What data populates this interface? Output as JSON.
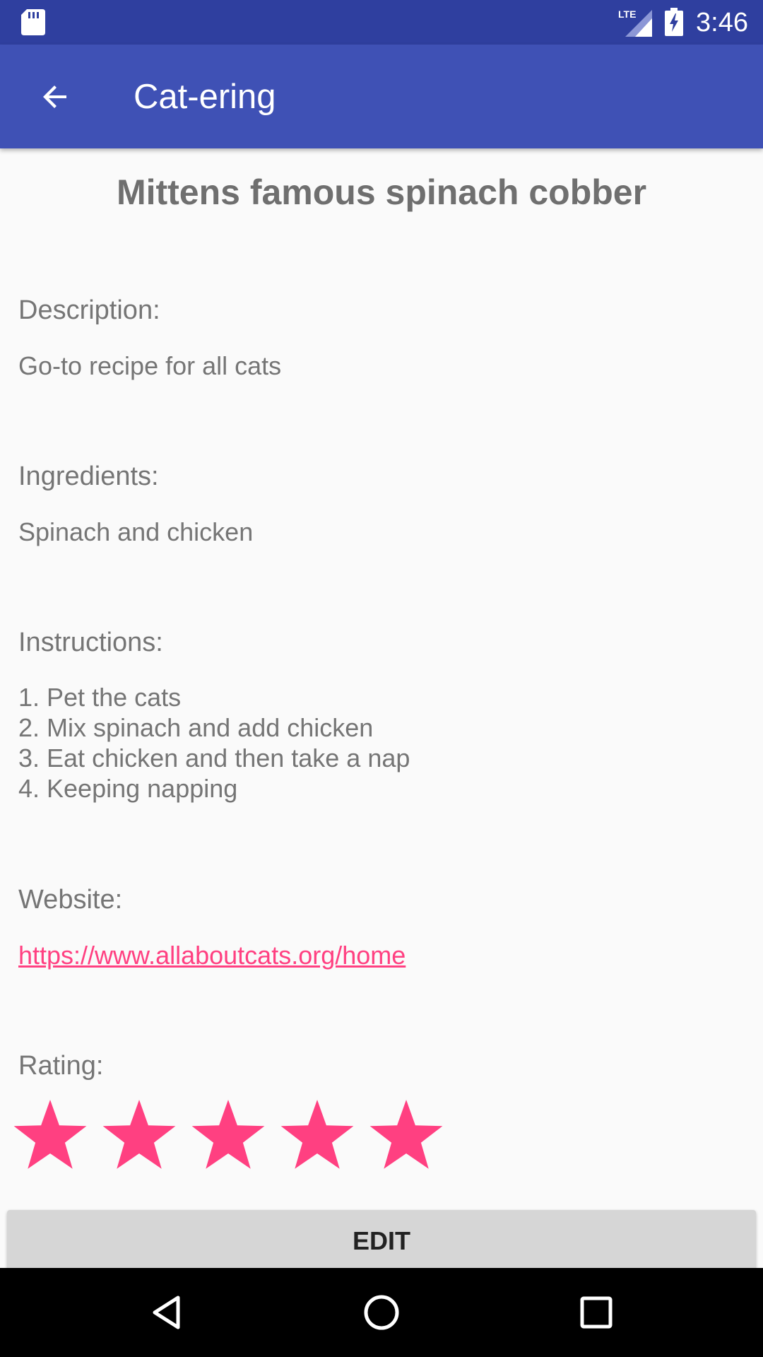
{
  "status_bar": {
    "time": "3:46",
    "network": "LTE",
    "icons": [
      "sd-card-icon",
      "lte-signal-icon",
      "battery-charging-icon"
    ]
  },
  "app_bar": {
    "title": "Cat-ering",
    "back_icon": "arrow-back-icon"
  },
  "recipe": {
    "title": "Mittens famous spinach cobber",
    "description_label": "Description:",
    "description": "Go-to recipe for all cats",
    "ingredients_label": "Ingredients:",
    "ingredients": "Spinach and chicken",
    "instructions_label": "Instructions:",
    "instructions": [
      "1. Pet the cats",
      "2. Mix spinach and add chicken",
      "3. Eat chicken and then take a nap",
      "4. Keeping napping"
    ],
    "website_label": "Website:",
    "website": "https://www.allaboutcats.org/home",
    "rating_label": "Rating:",
    "rating": 5,
    "rating_max": 5
  },
  "edit_button": {
    "label": "EDIT"
  },
  "nav_bar": {
    "icons": [
      "nav-back-icon",
      "nav-home-icon",
      "nav-recents-icon"
    ]
  },
  "colors": {
    "status_bar": "#2f3f9f",
    "app_bar": "#3f51b5",
    "accent": "#ff4081",
    "text": "#757575",
    "button": "#d6d6d6"
  }
}
